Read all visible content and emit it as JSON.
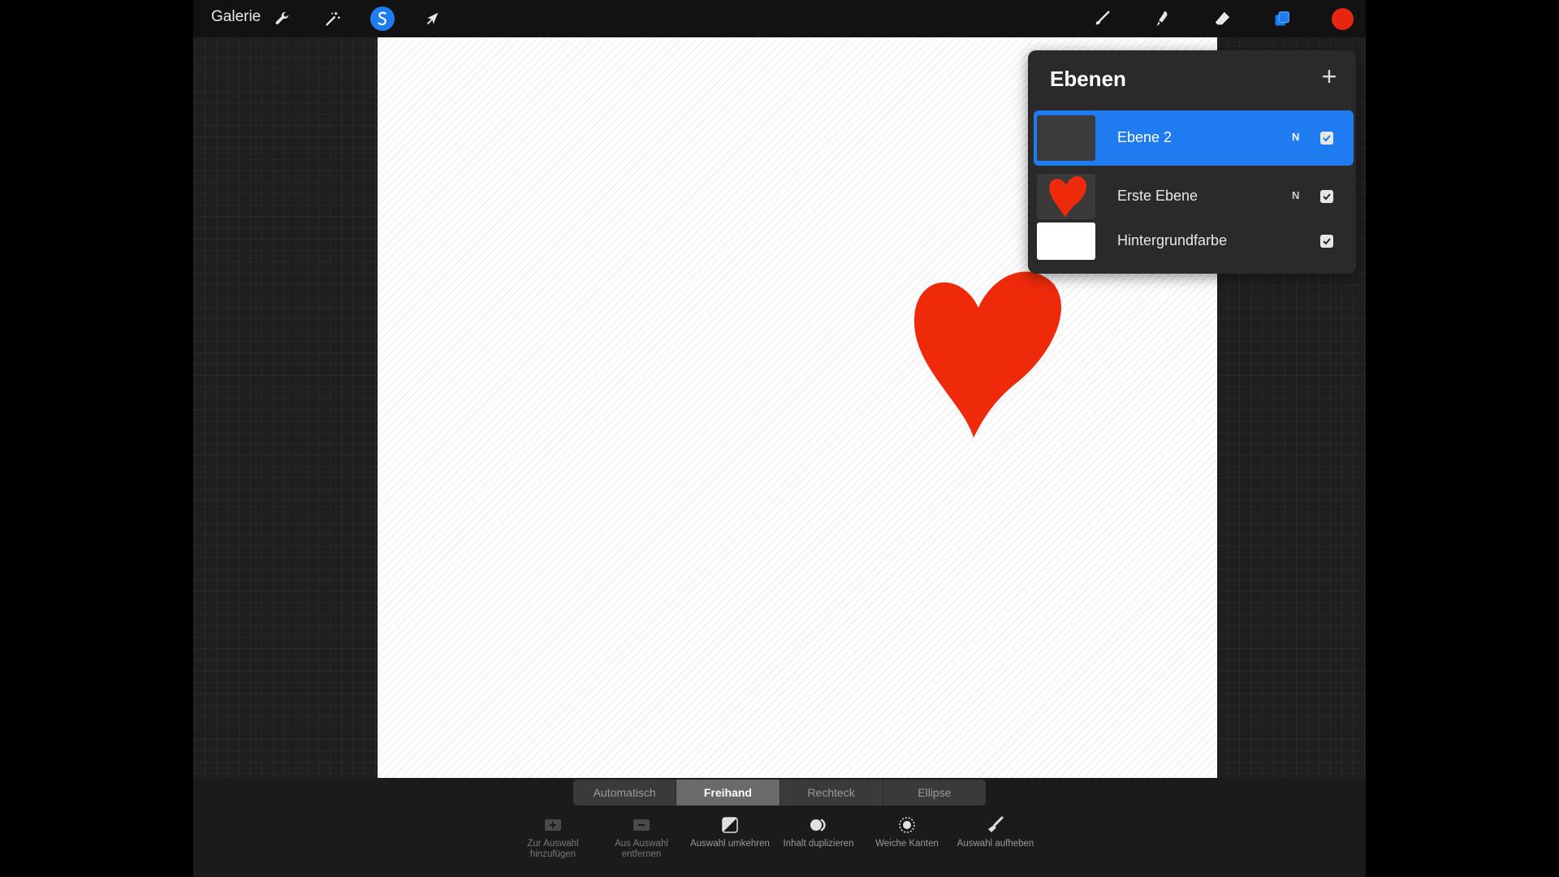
{
  "topbar": {
    "gallery_label": "Galerie",
    "left_tools": [
      {
        "name": "actions",
        "icon": "wrench-icon"
      },
      {
        "name": "adjustments",
        "icon": "magic-wand-icon"
      },
      {
        "name": "selection",
        "icon": "selection-s-icon",
        "active": true
      },
      {
        "name": "transform",
        "icon": "arrow-cursor-icon"
      }
    ],
    "right_tools": [
      {
        "name": "brush",
        "icon": "brush-icon"
      },
      {
        "name": "smudge",
        "icon": "smudge-icon"
      },
      {
        "name": "eraser",
        "icon": "eraser-icon"
      },
      {
        "name": "layers",
        "icon": "layers-icon",
        "active": true
      },
      {
        "name": "color",
        "icon": "color-swatch",
        "color": "#e8260f"
      }
    ]
  },
  "canvas": {
    "content": "heart drawing",
    "heart_color": "#ee2a0b"
  },
  "layers_panel": {
    "title": "Ebenen",
    "add_icon": "plus-icon",
    "layers": [
      {
        "name": "Ebene 2",
        "blend": "N",
        "visible": true,
        "selected": true,
        "thumb": "dark"
      },
      {
        "name": "Erste Ebene",
        "blend": "N",
        "visible": true,
        "selected": false,
        "thumb": "heart"
      },
      {
        "name": "Hintergrundfarbe",
        "blend": "",
        "visible": true,
        "selected": false,
        "thumb": "white"
      }
    ],
    "accent": "#1e7cf0"
  },
  "selection_bar": {
    "modes": [
      "Automatisch",
      "Freihand",
      "Rechteck",
      "Ellipse"
    ],
    "active_mode": "Freihand",
    "tools": [
      {
        "label": "Zur Auswahl hinzufügen",
        "line1": "Zur Auswahl",
        "line2": "hinzufügen",
        "icon": "add-to-selection-icon"
      },
      {
        "label": "Aus Auswahl entfernen",
        "line1": "Aus Auswahl",
        "line2": "entfernen",
        "icon": "remove-from-selection-icon"
      },
      {
        "label": "Auswahl umkehren",
        "line1": "Auswahl umkehren",
        "line2": "",
        "icon": "invert-selection-icon"
      },
      {
        "label": "Inhalt duplizieren",
        "line1": "Inhalt duplizieren",
        "line2": "",
        "icon": "duplicate-content-icon"
      },
      {
        "label": "Weiche Kanten",
        "line1": "Weiche Kanten",
        "line2": "",
        "icon": "feather-edges-icon"
      },
      {
        "label": "Auswahl aufheben",
        "line1": "Auswahl aufheben",
        "line2": "",
        "icon": "clear-selection-icon"
      }
    ]
  }
}
